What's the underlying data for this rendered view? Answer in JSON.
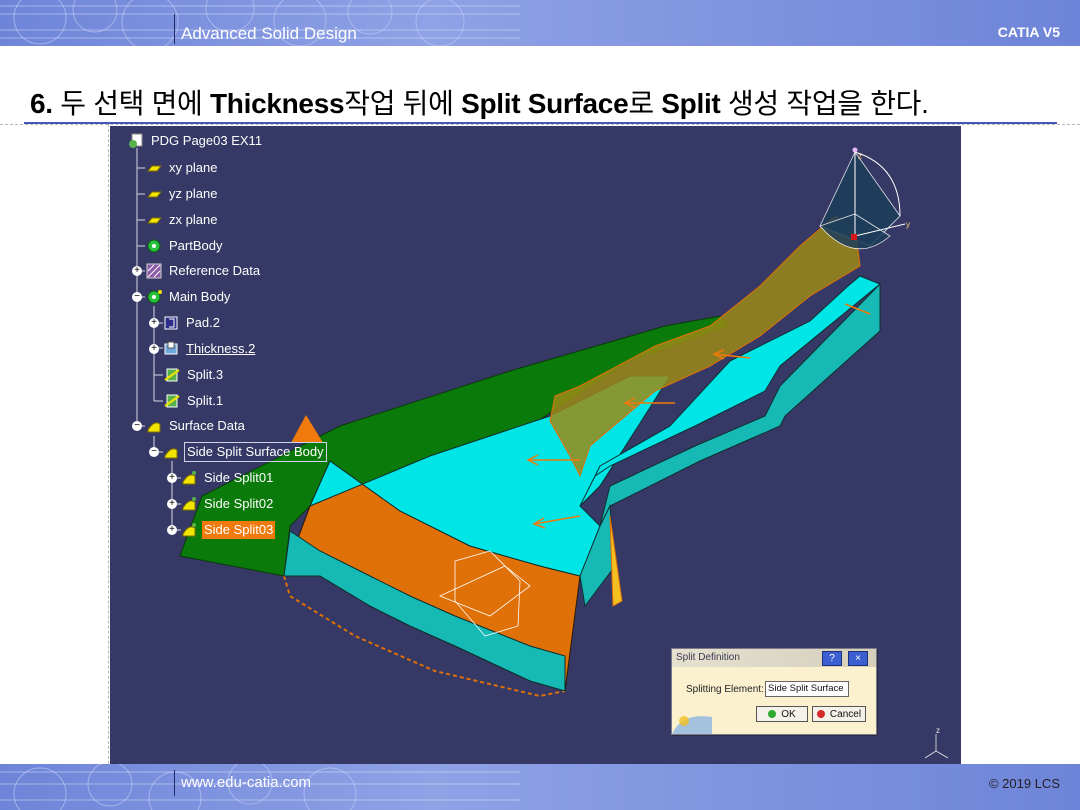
{
  "header": {
    "title": "Advanced Solid Design",
    "brand": "CATIA V5"
  },
  "heading": {
    "num": "6.",
    "p1": "두 선택 면에",
    "k1": "Thickness",
    "p2": "작업 뒤에",
    "k2": "Split Surface",
    "p3": "로",
    "k3": "Split",
    "p4": "생성 작업을 한다."
  },
  "tree": {
    "root": "PDG Page03 EX11",
    "xy": "xy plane",
    "yz": "yz plane",
    "zx": "zx plane",
    "partbody": "PartBody",
    "refdata": "Reference Data",
    "mainbody": "Main Body",
    "pad": "Pad.2",
    "thickness": "Thickness.2",
    "split3": "Split.3",
    "split1": "Split.1",
    "surfdata": "Surface Data",
    "sidebody": "Side Split Surface Body",
    "side01": "Side Split01",
    "side02": "Side Split02",
    "side03": "Side Split03"
  },
  "compass": {
    "z": "z",
    "y": "y",
    "x": "x"
  },
  "dialog": {
    "title": "Split Definition",
    "help": "?",
    "close": "×",
    "label": "Splitting Element:",
    "value": "Side Split Surface",
    "ok": "OK",
    "cancel": "Cancel"
  },
  "footer": {
    "url": "www.edu-catia.com",
    "copyright": "© 2019 LCS"
  },
  "colors": {
    "viewport_bg": "#363965",
    "selection": "#f07a0c",
    "surface_green": "#0a7a0a",
    "surface_cyan": "#00e0e0",
    "surface_orange": "#e07008",
    "surface_olive": "#9b8a16",
    "bar_blue": "#7a8ee0"
  }
}
